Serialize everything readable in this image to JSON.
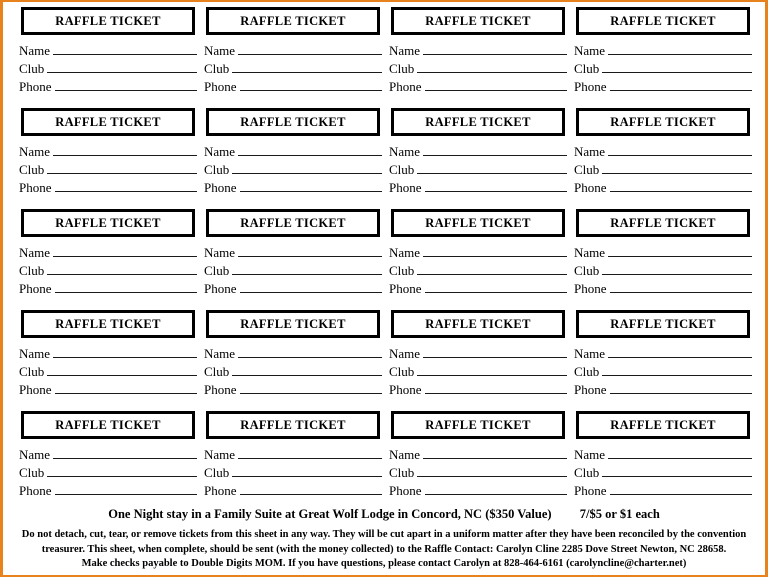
{
  "document": {
    "title": "Raffle Ticket Sheet",
    "border_color": "#E8821C"
  },
  "ticket": {
    "header_label": "RAFFLE TICKET",
    "fields": [
      {
        "label": "Name"
      },
      {
        "label": "Club"
      },
      {
        "label": "Phone"
      }
    ]
  },
  "grid": {
    "columns": 4,
    "rows": 5,
    "total_tickets": 20
  },
  "footer": {
    "prize_text": "One Night stay in a Family Suite at Great Wolf  Lodge in Concord, NC  ($350 Value)",
    "price_text": "7/$5 or $1 each",
    "instructions": [
      "Do not detach, cut, tear, or remove tickets from this sheet in any way.  They will be cut apart in a uniform matter after they have been reconciled by the convention",
      "treasurer.  This sheet, when complete, should be sent (with the money collected) to the Raffle Contact:  Carolyn Cline 2285 Dove Street Newton, NC 28658.",
      "Make checks payable to Double Digits MOM.     If you have questions, please contact Carolyn at 828-464-6161 (carolyncline@charter.net)"
    ]
  }
}
